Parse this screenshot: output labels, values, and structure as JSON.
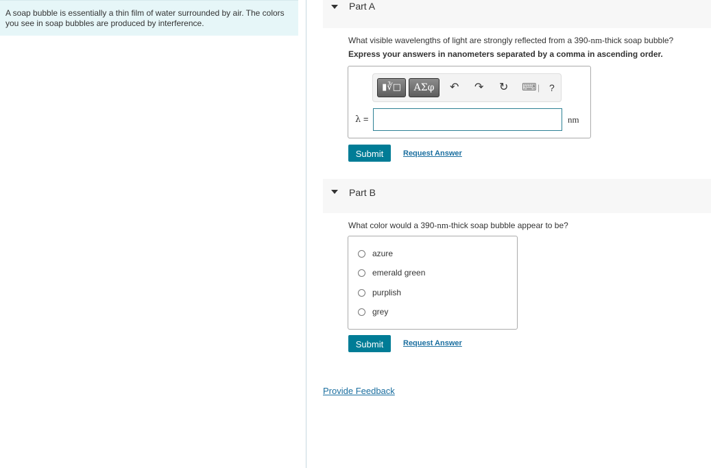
{
  "intro": {
    "text": "A soap bubble is essentially a thin film of water surrounded by air. The colors you see in soap bubbles are produced by interference."
  },
  "part_a": {
    "title": "Part A",
    "question_before": "What visible wavelengths of light are strongly reflected from a 390-",
    "question_unit": "nm",
    "question_after": "-thick soap bubble?",
    "instruction": "Express your answers in nanometers separated by a comma in ascending order.",
    "toolbar": {
      "templates_label": "▮∛□",
      "greek_label": "ΑΣφ",
      "undo_icon": "↶",
      "redo_icon": "↷",
      "reset_icon": "↻",
      "keyboard_icon": "⌨",
      "help_label": "?"
    },
    "variable_symbol": "λ",
    "variable_eq": " =",
    "answer_value": "",
    "unit": "nm",
    "submit_label": "Submit",
    "request_answer_label": "Request Answer"
  },
  "part_b": {
    "title": "Part B",
    "question_before": "What color would a 390-",
    "question_unit": "nm",
    "question_after": "-thick soap bubble appear to be?",
    "choices": [
      {
        "label": "azure",
        "selected": false
      },
      {
        "label": "emerald green",
        "selected": false
      },
      {
        "label": "purplish",
        "selected": false
      },
      {
        "label": "grey",
        "selected": false
      }
    ],
    "submit_label": "Submit",
    "request_answer_label": "Request Answer"
  },
  "footer": {
    "feedback_label": "Provide Feedback"
  }
}
